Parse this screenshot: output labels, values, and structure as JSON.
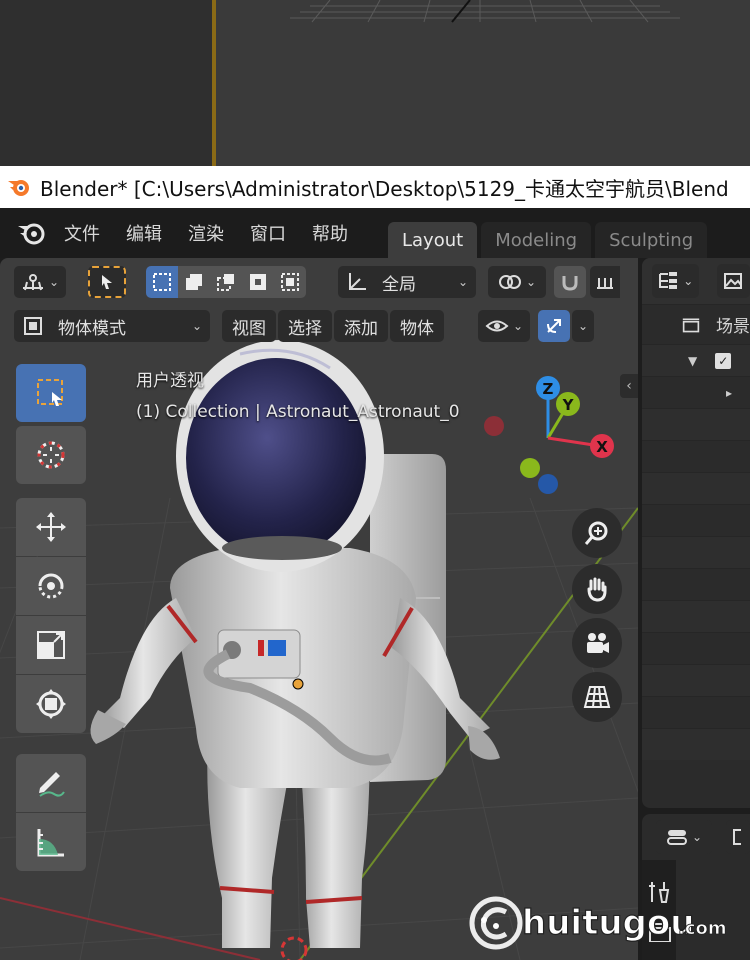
{
  "window": {
    "title": "Blender* [C:\\Users\\Administrator\\Desktop\\5129_卡通太空宇航员\\Blend"
  },
  "menu": {
    "items": [
      "文件",
      "编辑",
      "渲染",
      "窗口",
      "帮助"
    ]
  },
  "workspaces": {
    "tabs": [
      "Layout",
      "Modeling",
      "Sculpting"
    ],
    "active": "Layout"
  },
  "viewport_header": {
    "transform_orientation": "全局",
    "mode": "物体模式",
    "menus": [
      "视图",
      "选择",
      "添加",
      "物体"
    ]
  },
  "overlay": {
    "view_name": "用户透视",
    "object_info": "(1) Collection | Astronaut_Astronaut_0"
  },
  "gizmo": {
    "x_label": "X",
    "y_label": "Y",
    "z_label": "Z",
    "colors": {
      "x": "#e0344c",
      "y": "#8ab81c",
      "z": "#2e8ee6"
    }
  },
  "outliner": {
    "scene_label": "场景"
  },
  "colors": {
    "accent_blue": "#4772b3",
    "header_bg": "#1c1c1c",
    "viewport_bg": "#3d3d3d",
    "active_border_orange": "#e8a33a"
  },
  "watermark": {
    "text": "huitugou",
    "suffix": ".com"
  }
}
